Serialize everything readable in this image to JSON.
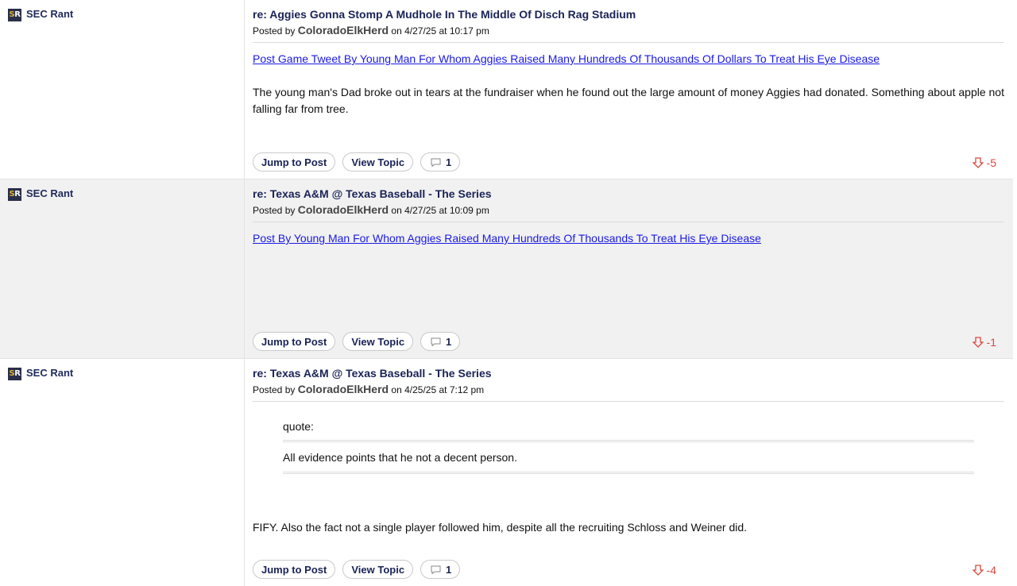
{
  "posts": [
    {
      "board": "SEC Rant",
      "board_icon": "SR",
      "title": "re: Aggies Gonna Stomp A Mudhole In The Middle Of Disch Rag Stadium",
      "posted_by_prefix": "Posted by",
      "author": "ColoradoElkHerd",
      "date_text": "on 4/27/25 at 10:17 pm",
      "link_text": "Post Game Tweet By Young Man For Whom Aggies Raised Many Hundreds Of Thousands Of Dollars To Treat His Eye Disease",
      "body": "The young man's Dad broke out in tears at the fundraiser when he found out the large amount of money Aggies had donated. Something about apple not falling far from tree.",
      "jump_label": "Jump to Post",
      "view_label": "View Topic",
      "comment_count": "1",
      "vote_score": "-5"
    },
    {
      "board": "SEC Rant",
      "board_icon": "SR",
      "title": "re: Texas A&M @ Texas Baseball - The Series",
      "posted_by_prefix": "Posted by",
      "author": "ColoradoElkHerd",
      "date_text": "on 4/27/25 at 10:09 pm",
      "link_text": "Post By Young Man For Whom Aggies Raised Many Hundreds Of Thousands To Treat His Eye Disease",
      "jump_label": "Jump to Post",
      "view_label": "View Topic",
      "comment_count": "1",
      "vote_score": "-1"
    },
    {
      "board": "SEC Rant",
      "board_icon": "SR",
      "title": "re: Texas A&M @ Texas Baseball - The Series",
      "posted_by_prefix": "Posted by",
      "author": "ColoradoElkHerd",
      "date_text": "on 4/25/25 at 7:12 pm",
      "quote_label": "quote:",
      "quote_text": "All evidence points that he not a decent person.",
      "body": "FIFY. Also the fact not a single player followed him, despite all the recruiting Schloss and Weiner did.",
      "jump_label": "Jump to Post",
      "view_label": "View Topic",
      "comment_count": "1",
      "vote_score": "-4"
    }
  ],
  "colors": {
    "title": "#1a2356",
    "link": "#1a1ae6",
    "downvote": "#d9473f",
    "shaded_row": "#f1f1f1"
  },
  "icons": {
    "board": "sec-rant-logo",
    "comment": "speech-bubble-icon",
    "vote": "thumbs-down-icon"
  }
}
